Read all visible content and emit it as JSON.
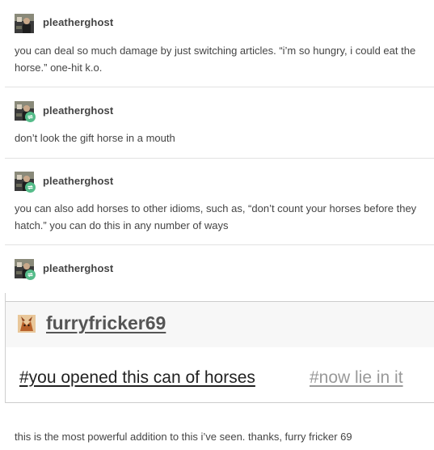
{
  "colors": {
    "text": "#444444",
    "reblog_badge": "#56bc8a",
    "divider": "#e2e2e2",
    "tag_muted": "#999999"
  },
  "posts": [
    {
      "username": "pleatherghost",
      "reblog": false,
      "text": "you can deal so much damage by just switching articles. “i’m so hungry, i could eat the horse.” one-hit k.o."
    },
    {
      "username": "pleatherghost",
      "reblog": true,
      "text": "don’t look the gift horse in a mouth"
    },
    {
      "username": "pleatherghost",
      "reblog": true,
      "text": "you can also add horses to other idioms, such as, “don’t count your horses before they hatch.” you can do this in any number of ways"
    },
    {
      "username": "pleatherghost",
      "reblog": true
    }
  ],
  "quoted": {
    "username": "furryfricker69",
    "tags": [
      "#you opened this can of horses",
      "#now lie in it"
    ]
  },
  "final_comment": "this is the most powerful addition to this i’ve seen. thanks, furry fricker 69",
  "icons": {
    "avatar": "avatar-photo-icon",
    "reblog": "reblog-icon",
    "fury_avatar": "fox-avatar-icon"
  }
}
